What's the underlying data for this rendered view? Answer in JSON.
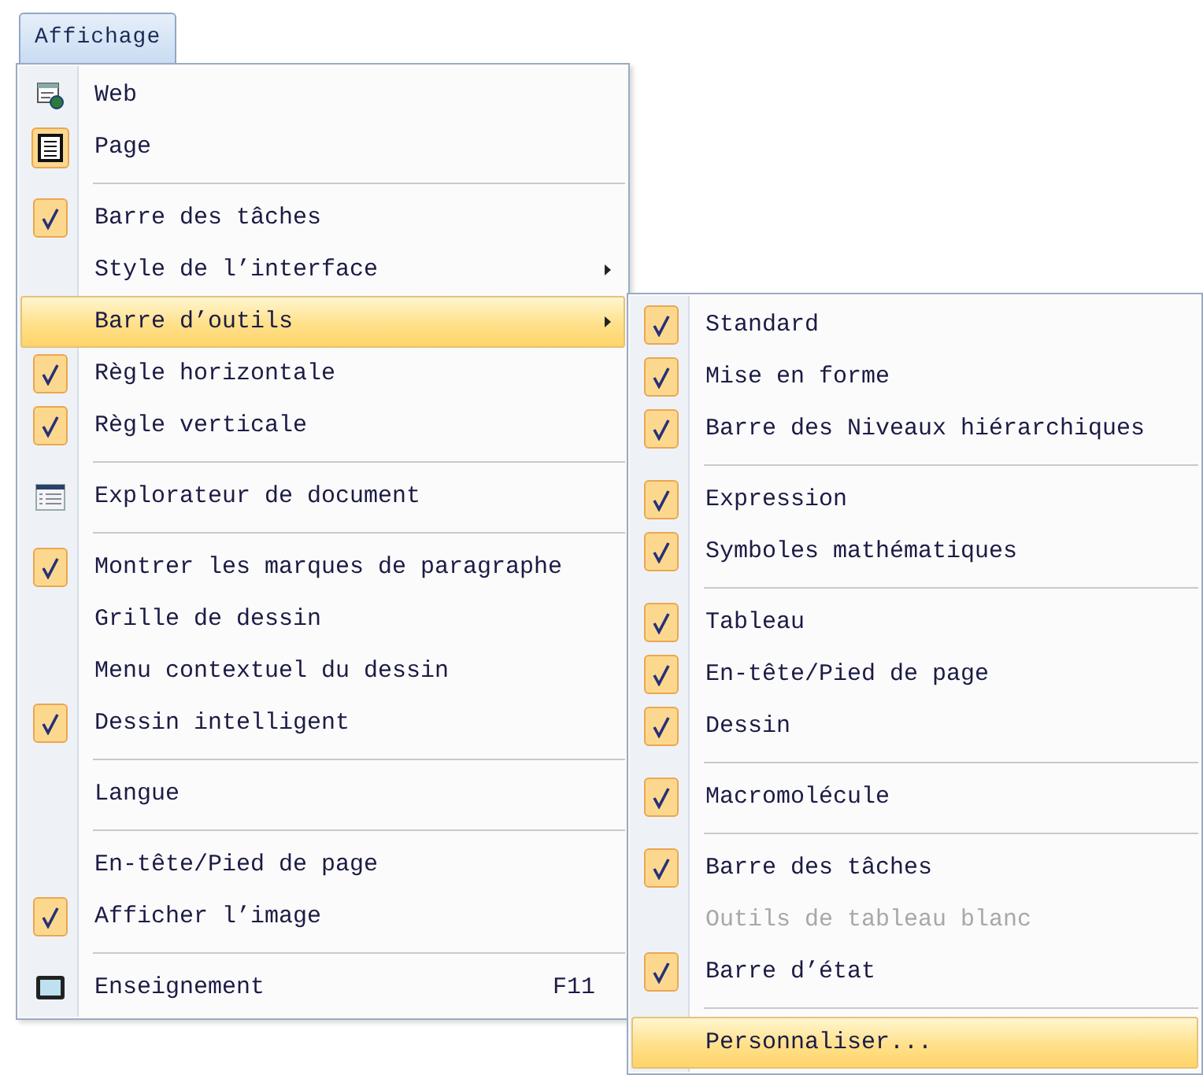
{
  "menu_bar": {
    "title": "Affichage"
  },
  "menu": {
    "items": [
      {
        "kind": "web",
        "label": "Web",
        "checked": false,
        "selected": false,
        "submenu": false
      },
      {
        "kind": "page",
        "label": "Page",
        "checked": true,
        "selected": false,
        "submenu": false
      },
      {
        "kind": "separator"
      },
      {
        "kind": "check",
        "label": "Barre des tâches",
        "checked": true,
        "selected": false,
        "submenu": false
      },
      {
        "kind": "check",
        "label": "Style de l’interface",
        "checked": false,
        "selected": false,
        "submenu": true
      },
      {
        "kind": "check",
        "label": "Barre d’outils",
        "checked": false,
        "selected": true,
        "submenu": true
      },
      {
        "kind": "check",
        "label": "Règle horizontale",
        "checked": true,
        "selected": false,
        "submenu": false
      },
      {
        "kind": "check",
        "label": "Règle verticale",
        "checked": true,
        "selected": false,
        "submenu": false
      },
      {
        "kind": "separator"
      },
      {
        "kind": "explorer",
        "label": "Explorateur de document",
        "checked": false,
        "selected": false,
        "submenu": false
      },
      {
        "kind": "separator"
      },
      {
        "kind": "check",
        "label": "Montrer les marques de paragraphe",
        "checked": true,
        "selected": false,
        "submenu": false
      },
      {
        "kind": "check",
        "label": "Grille de dessin",
        "checked": false,
        "selected": false,
        "submenu": false
      },
      {
        "kind": "check",
        "label": "Menu contextuel du dessin",
        "checked": false,
        "selected": false,
        "submenu": false
      },
      {
        "kind": "check",
        "label": "Dessin intelligent",
        "checked": true,
        "selected": false,
        "submenu": false
      },
      {
        "kind": "separator"
      },
      {
        "kind": "check",
        "label": "Langue",
        "checked": false,
        "selected": false,
        "submenu": false
      },
      {
        "kind": "separator"
      },
      {
        "kind": "check",
        "label": "En-tête/Pied de page",
        "checked": false,
        "selected": false,
        "submenu": false
      },
      {
        "kind": "check",
        "label": "Afficher l’image",
        "checked": true,
        "selected": false,
        "submenu": false
      },
      {
        "kind": "separator"
      },
      {
        "kind": "screen",
        "label": "Enseignement",
        "checked": false,
        "selected": false,
        "submenu": false,
        "shortcut": "F11"
      }
    ]
  },
  "submenu": {
    "items": [
      {
        "kind": "check",
        "label": "Standard",
        "checked": true,
        "selected": false,
        "disabled": false
      },
      {
        "kind": "check",
        "label": "Mise en forme",
        "checked": true,
        "selected": false,
        "disabled": false
      },
      {
        "kind": "check",
        "label": "Barre des Niveaux hiérarchiques",
        "checked": true,
        "selected": false,
        "disabled": false
      },
      {
        "kind": "separator"
      },
      {
        "kind": "check",
        "label": "Expression",
        "checked": true,
        "selected": false,
        "disabled": false
      },
      {
        "kind": "check",
        "label": "Symboles mathématiques",
        "checked": true,
        "selected": false,
        "disabled": false
      },
      {
        "kind": "separator"
      },
      {
        "kind": "check",
        "label": "Tableau",
        "checked": true,
        "selected": false,
        "disabled": false
      },
      {
        "kind": "check",
        "label": "En-tête/Pied de page",
        "checked": true,
        "selected": false,
        "disabled": false
      },
      {
        "kind": "check",
        "label": "Dessin",
        "checked": true,
        "selected": false,
        "disabled": false
      },
      {
        "kind": "separator"
      },
      {
        "kind": "check",
        "label": "Macromolécule",
        "checked": true,
        "selected": false,
        "disabled": false
      },
      {
        "kind": "separator"
      },
      {
        "kind": "check",
        "label": "Barre des tâches",
        "checked": true,
        "selected": false,
        "disabled": false
      },
      {
        "kind": "check",
        "label": "Outils de tableau blanc",
        "checked": false,
        "selected": false,
        "disabled": true
      },
      {
        "kind": "check",
        "label": "Barre d’état",
        "checked": true,
        "selected": false,
        "disabled": false
      },
      {
        "kind": "separator"
      },
      {
        "kind": "check",
        "label": "Personnaliser...",
        "checked": false,
        "selected": true,
        "disabled": false
      }
    ]
  }
}
